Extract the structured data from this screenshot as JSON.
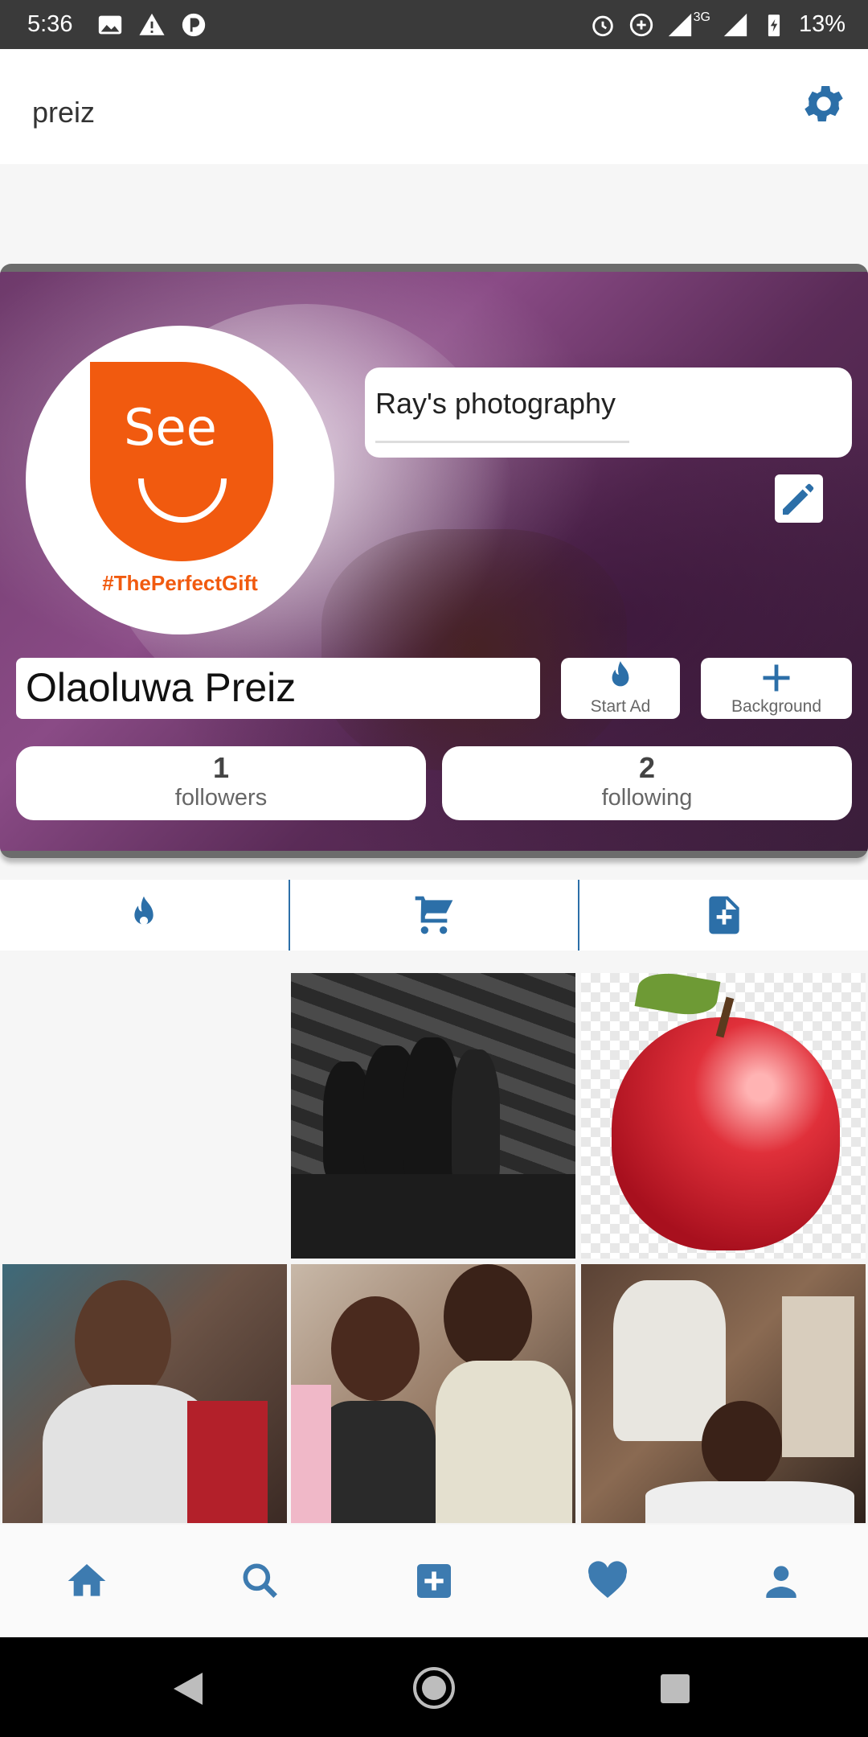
{
  "status_bar": {
    "time": "5:36",
    "network": "3G",
    "battery": "13%"
  },
  "app_bar": {
    "title": "preiz",
    "settings_icon": "gear-icon"
  },
  "profile": {
    "logo_word": "See",
    "logo_tagline": "#ThePerfectGift",
    "business_name": "Ray's photography",
    "display_name": "Olaoluwa Preiz",
    "start_ad_label": "Start Ad",
    "background_label": "Background",
    "followers": {
      "count": "1",
      "label": "followers"
    },
    "following": {
      "count": "2",
      "label": "following"
    }
  },
  "tabs": [
    {
      "icon": "flame-icon"
    },
    {
      "icon": "cart-icon"
    },
    {
      "icon": "add-document-icon"
    }
  ],
  "bottom_nav": [
    {
      "icon": "home-icon"
    },
    {
      "icon": "search-icon"
    },
    {
      "icon": "add-box-icon"
    },
    {
      "icon": "heart-icon"
    },
    {
      "icon": "person-icon"
    }
  ],
  "colors": {
    "accent": "#2c6fa8",
    "logo": "#f15a0f"
  }
}
